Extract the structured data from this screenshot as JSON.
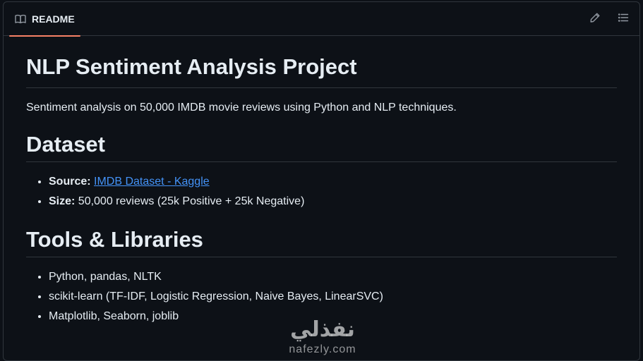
{
  "tab": {
    "label": "README"
  },
  "icons": {
    "tab": "book-icon",
    "edit": "pencil-icon",
    "outline": "list-icon"
  },
  "colors": {
    "background": "#0d1117",
    "text": "#e6edf3",
    "link": "#4493f8",
    "tab_underline": "#f78166",
    "border": "#30363d"
  },
  "readme": {
    "title": "NLP Sentiment Analysis Project",
    "description": "Sentiment analysis on 50,000 IMDB movie reviews using Python and NLP techniques.",
    "dataset": {
      "heading": "Dataset",
      "source_label": "Source:",
      "source_link": "IMDB Dataset - Kaggle",
      "size_label": "Size:",
      "size_value": " 50,000 reviews (25k Positive + 25k Negative)"
    },
    "tools": {
      "heading": "Tools & Libraries",
      "items": [
        "Python, pandas, NLTK",
        "scikit-learn (TF-IDF, Logistic Regression, Naive Bayes, LinearSVC)",
        "Matplotlib, Seaborn, joblib"
      ]
    }
  },
  "watermark": {
    "arabic": "نفذلي",
    "latin": "nafezly.com"
  }
}
